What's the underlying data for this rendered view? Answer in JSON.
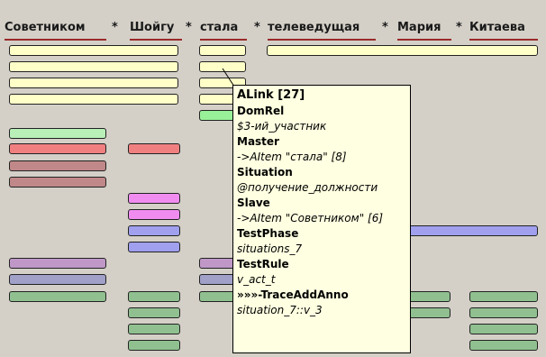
{
  "header": {
    "words": [
      "Советником",
      "Шойгу",
      "стала",
      "телеведущая",
      "Мария",
      "Китаева"
    ],
    "separator": "*"
  },
  "colors": {
    "yellow": "#ffffc8",
    "green_light": "#b8f0b8",
    "green_bright": "#98f098",
    "red": "#f08080",
    "rose_brown": "#c08888",
    "magenta": "#f08cf0",
    "blue": "#a0a0ee",
    "purple": "#c098c8",
    "gray_blue": "#a0a0c8",
    "green_sage": "#90c090",
    "underline": "#9a2a2a"
  },
  "tooltip": {
    "title": "ALink [27]",
    "fields": [
      {
        "key": "DomRel",
        "value": "$3-ий_участник"
      },
      {
        "key": "Master",
        "value": "->AItem \"стала\" [8]"
      },
      {
        "key": "Situation",
        "value": "@получение_должности"
      },
      {
        "key": "Slave",
        "value": "->AItem \"Советником\" [6]"
      },
      {
        "key": "TestPhase",
        "value": "situations_7"
      },
      {
        "key": "TestRule",
        "value": "v_act_t"
      },
      {
        "key": "»»»-TraceAddAnno",
        "value": "situation_7::v_3"
      }
    ]
  }
}
